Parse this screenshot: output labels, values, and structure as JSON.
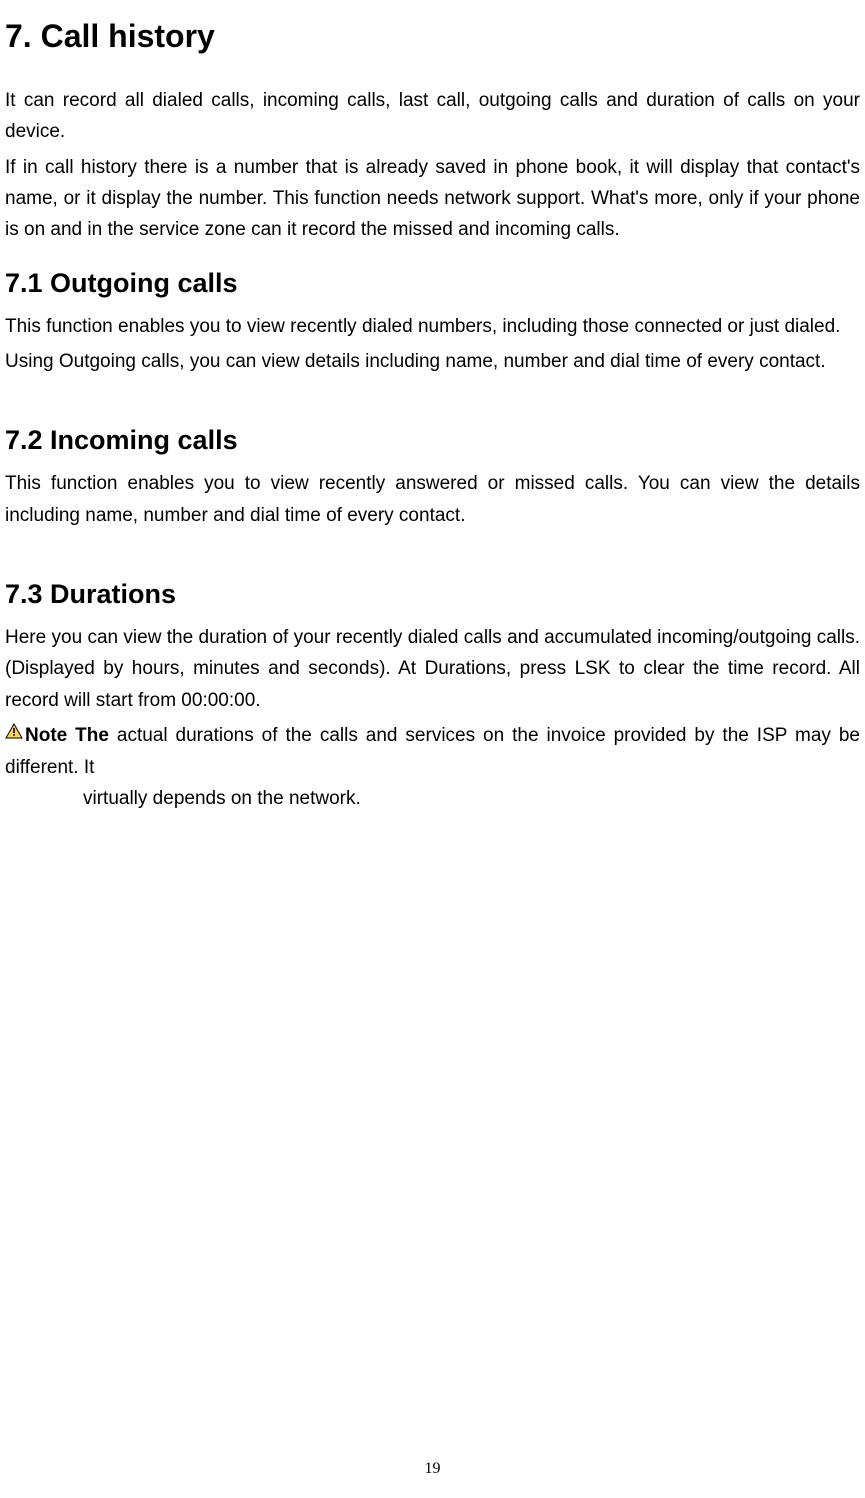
{
  "h1": "7. Call history",
  "intro1": "It can record all dialed calls, incoming calls, last call, outgoing calls and duration of calls on your device.",
  "intro2": "If in call history there is a number that is already saved in phone book, it will display that contact's name, or it display the number. This function needs network support. What's more, only if your phone is on and in the service zone can it record the missed and incoming calls.",
  "s71": {
    "heading": "7.1 Outgoing calls",
    "p1": "This function enables you to view recently dialed numbers, including those connected or just dialed.",
    "p2": "Using Outgoing calls, you can view details including name, number and dial time of every contact."
  },
  "s72": {
    "heading": "7.2 Incoming calls",
    "p1": "This function enables you to view recently answered or missed calls. You can view the details including name, number and dial time of every contact."
  },
  "s73": {
    "heading": "7.3 Durations",
    "p1": "Here you can view the duration of your recently dialed calls and accumulated incoming/outgoing calls. (Displayed by hours, minutes and seconds).   At Durations, press LSK to clear the time record. All record will start from 00:00:00.",
    "note_bold": "Note The",
    "note_rest": " actual durations of the calls and services on the invoice provided by the ISP may be different. It",
    "note_line2": "virtually depends on the network."
  },
  "page_number": "19"
}
